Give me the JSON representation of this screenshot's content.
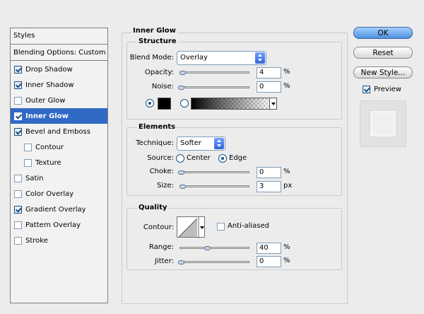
{
  "styles_panel": {
    "header": "Styles",
    "blending_options": "Blending Options: Custom",
    "items": [
      {
        "label": "Drop Shadow",
        "checked": true
      },
      {
        "label": "Inner Shadow",
        "checked": true
      },
      {
        "label": "Outer Glow",
        "checked": false
      },
      {
        "label": "Inner Glow",
        "checked": true,
        "selected": true
      },
      {
        "label": "Bevel and Emboss",
        "checked": true
      },
      {
        "label": "Contour",
        "checked": false,
        "indent": true
      },
      {
        "label": "Texture",
        "checked": false,
        "indent": true
      },
      {
        "label": "Satin",
        "checked": false
      },
      {
        "label": "Color Overlay",
        "checked": false
      },
      {
        "label": "Gradient Overlay",
        "checked": true
      },
      {
        "label": "Pattern Overlay",
        "checked": false
      },
      {
        "label": "Stroke",
        "checked": false
      }
    ]
  },
  "inner_glow": {
    "title": "Inner Glow",
    "structure": {
      "title": "Structure",
      "blend_mode_label": "Blend Mode:",
      "blend_mode_value": "Overlay",
      "opacity_label": "Opacity:",
      "opacity_value": "4",
      "opacity_unit": "%",
      "noise_label": "Noise:",
      "noise_value": "0",
      "noise_unit": "%",
      "color_swatch": "#000000"
    },
    "elements": {
      "title": "Elements",
      "technique_label": "Technique:",
      "technique_value": "Softer",
      "source_label": "Source:",
      "source_center": "Center",
      "source_edge": "Edge",
      "choke_label": "Choke:",
      "choke_value": "0",
      "choke_unit": "%",
      "size_label": "Size:",
      "size_value": "3",
      "size_unit": "px"
    },
    "quality": {
      "title": "Quality",
      "contour_label": "Contour:",
      "anti_aliased_label": "Anti-aliased",
      "range_label": "Range:",
      "range_value": "40",
      "range_unit": "%",
      "jitter_label": "Jitter:",
      "jitter_value": "0",
      "jitter_unit": "%"
    }
  },
  "buttons": {
    "ok": "OK",
    "reset": "Reset",
    "new_style": "New Style...",
    "preview_label": "Preview"
  },
  "colors": {
    "selection": "#316ac5",
    "primary_button": "#4c8fdf"
  }
}
